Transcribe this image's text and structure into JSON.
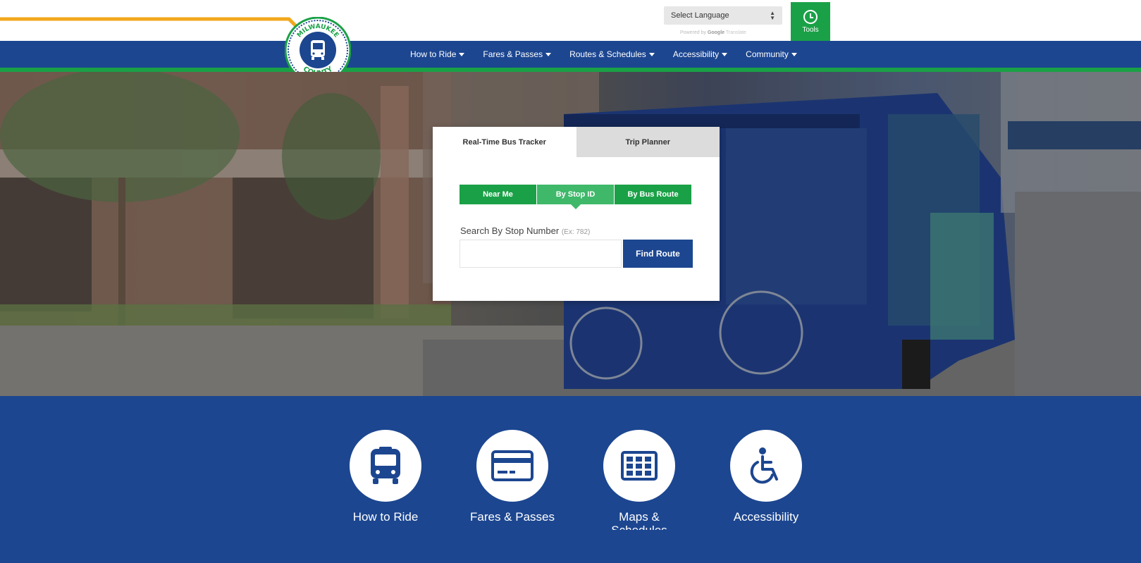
{
  "header": {
    "language_select": {
      "label": "Select Language"
    },
    "powered_by": {
      "prefix": "Powered by",
      "brand": "Google",
      "product": "Translate"
    },
    "tools": {
      "label": "Tools",
      "icon": "clock-icon"
    },
    "logo": {
      "top_text": "MILWAUKEE",
      "bottom_text": "COUNTY",
      "icon": "bus-icon"
    }
  },
  "nav": {
    "items": [
      {
        "label": "How to Ride"
      },
      {
        "label": "Fares & Passes"
      },
      {
        "label": "Routes & Schedules"
      },
      {
        "label": "Accessibility"
      },
      {
        "label": "Community"
      }
    ]
  },
  "widget": {
    "tabs": [
      {
        "label": "Real-Time Bus Tracker",
        "active": true
      },
      {
        "label": "Trip Planner",
        "active": false
      }
    ],
    "modes": [
      {
        "label": "Near Me",
        "active": false
      },
      {
        "label": "By Stop ID",
        "active": true
      },
      {
        "label": "By Bus Route",
        "active": false
      }
    ],
    "search_label": "Search By Stop Number",
    "search_example": "(Ex: 782)",
    "input_value": "",
    "button_label": "Find Route"
  },
  "quick_links": [
    {
      "label": "How to Ride",
      "icon": "bus-front-icon"
    },
    {
      "label": "Fares & Passes",
      "icon": "fare-card-icon"
    },
    {
      "label": "Maps & Schedules",
      "icon": "schedule-grid-icon"
    },
    {
      "label": "Accessibility",
      "icon": "wheelchair-icon"
    }
  ],
  "colors": {
    "brand_blue": "#1c4690",
    "brand_green": "#1aa147",
    "accent_orange": "#f2a81d"
  }
}
